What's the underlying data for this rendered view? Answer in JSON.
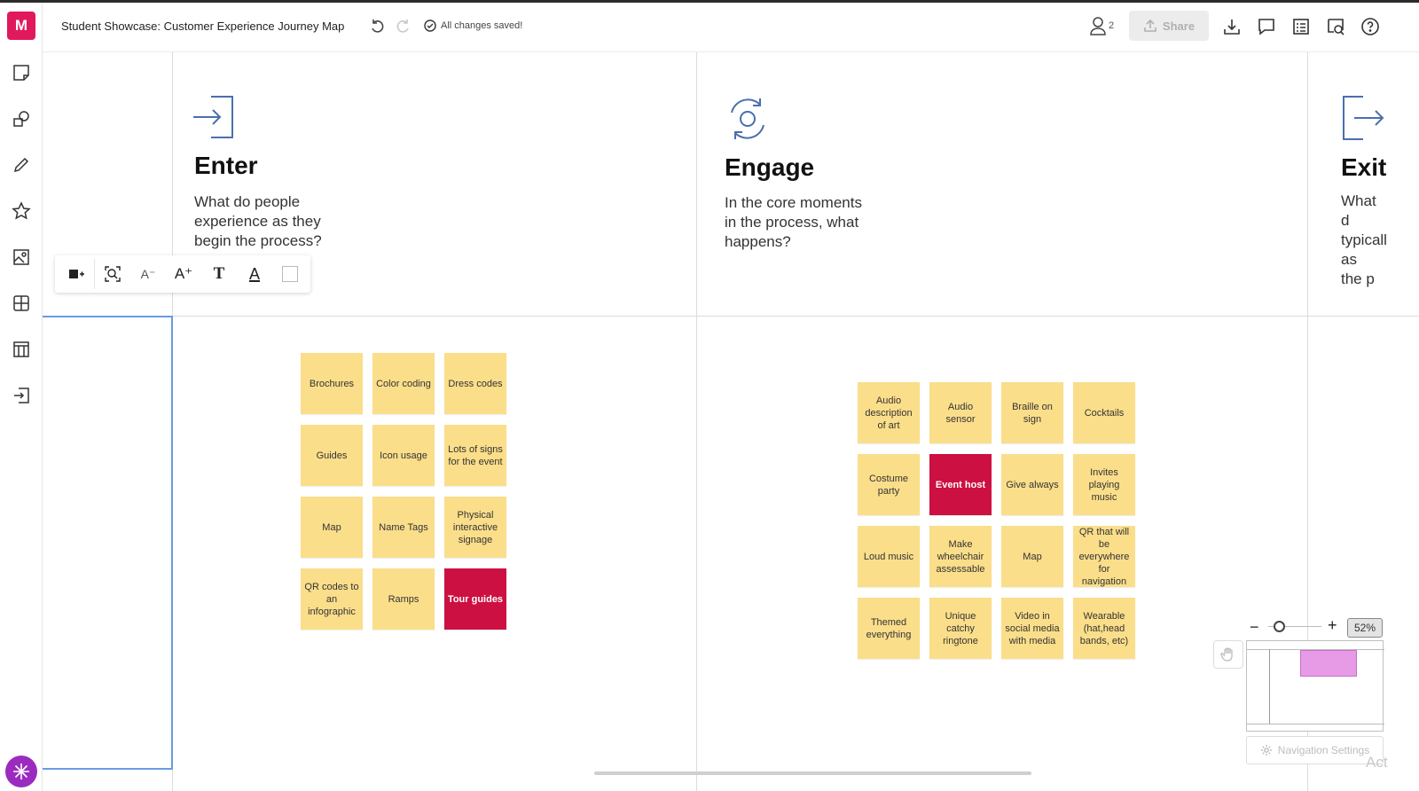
{
  "app": {
    "logo_letter": "M",
    "title": "Student Showcase: Customer Experience Journey Map",
    "save_status": "All changes saved!",
    "collaborator_count": "2",
    "share_label": "Share"
  },
  "leftbar": {
    "tools": [
      "sticky-note-icon",
      "shapes-icon",
      "pen-icon",
      "star-icon",
      "image-icon",
      "grid-icon",
      "table-icon",
      "exit-icon"
    ]
  },
  "header_icons": [
    "download-icon",
    "comment-icon",
    "list-icon",
    "search-board-icon",
    "help-icon"
  ],
  "text_toolbar": {
    "decrease": "A⁻",
    "increase": "A⁺",
    "font": "T",
    "color": "A"
  },
  "stages": [
    {
      "title": "Enter",
      "desc": "What do people experience as they begin the process?"
    },
    {
      "title": "Engage",
      "desc": "In the core moments in the process, what happens?"
    },
    {
      "title": "Exit",
      "desc": "What d typicall as the p"
    }
  ],
  "enter_notes": [
    "Brochures",
    "Color coding",
    "Dress codes",
    "Guides",
    "Icon usage",
    "Lots of signs for the event",
    "Map",
    "Name Tags",
    "Physical interactive signage",
    "QR codes to an infographic",
    "Ramps",
    "Tour guides"
  ],
  "engage_notes": [
    "Audio description of art",
    "Audio sensor",
    "Braille on sign",
    "Cocktails",
    "Costume party",
    "Event host",
    "Give always",
    "Invites playing music",
    "Loud music",
    "Make wheelchair assessable",
    "Map",
    "QR that will be everywhere for navigation",
    "Themed everything",
    "Unique catchy ringtone",
    "Video in social media with media",
    "Wearable (hat,head bands, etc)"
  ],
  "highlighted_notes": [
    "Tour guides",
    "Event host"
  ],
  "colors": {
    "sticky": "#fbde8a",
    "highlight": "#cc1042",
    "brand": "#e0195c"
  },
  "zoom": {
    "value": "52%",
    "minus": "−",
    "plus": "+"
  },
  "navigation_settings": "Navigation Settings",
  "watermark_fragment": "Act"
}
